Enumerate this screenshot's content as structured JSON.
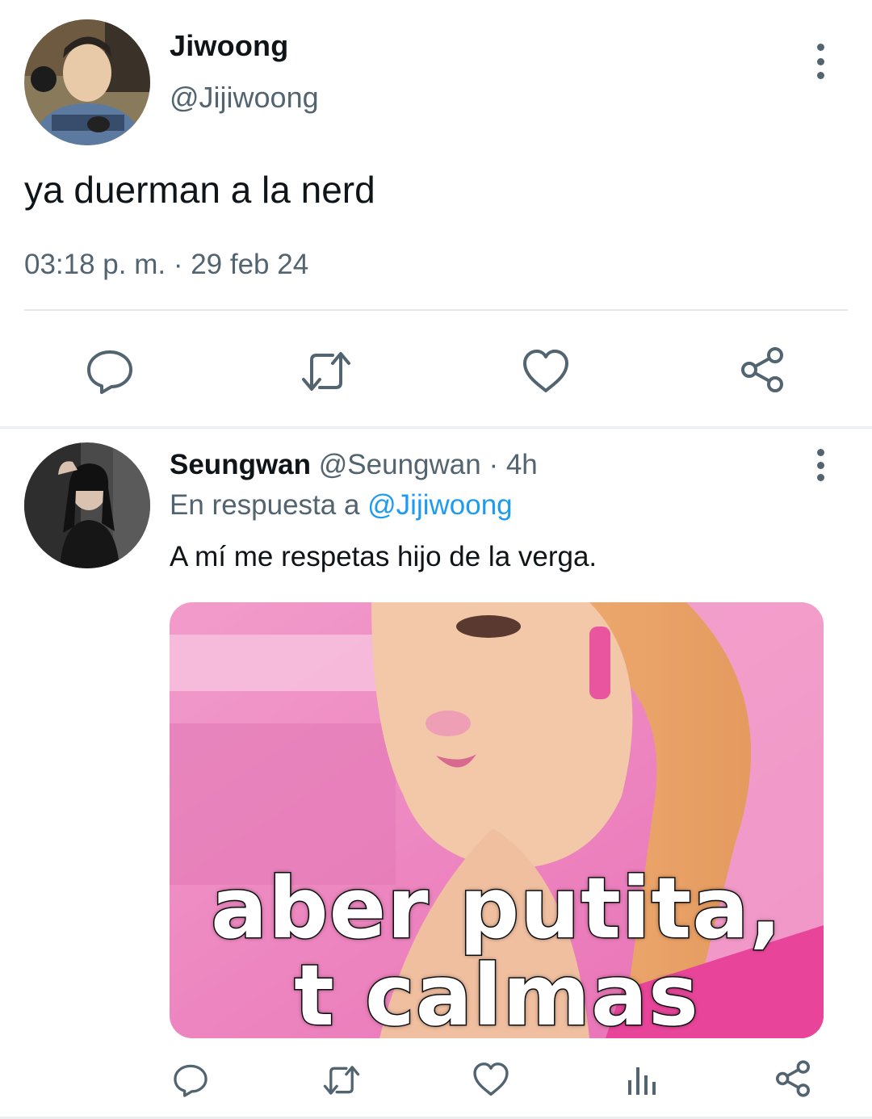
{
  "main_tweet": {
    "display_name": "Jiwoong",
    "handle": "@Jijiwoong",
    "text": "ya duerman a la nerd",
    "meta": "03:18 p. m. · 29 feb 24",
    "actions": [
      "reply-icon",
      "retweet-icon",
      "like-icon",
      "share-icon"
    ]
  },
  "reply_tweet": {
    "display_name": "Seungwan",
    "handle": "@Seungwan",
    "separator": " · ",
    "time": "4h",
    "reply_prefix": "En respuesta a ",
    "reply_to_handle": "@Jijiwoong",
    "text": "A mí me respetas hijo de la verga.",
    "image_caption_line1": "aber putita,",
    "image_caption_line2": "t calmas",
    "actions": [
      "reply-icon",
      "retweet-icon",
      "like-icon",
      "views-icon",
      "share-icon"
    ]
  },
  "colors": {
    "text_primary": "#0f1419",
    "text_secondary": "#536471",
    "link": "#1d9bf0",
    "divider": "#e6e9ec"
  }
}
